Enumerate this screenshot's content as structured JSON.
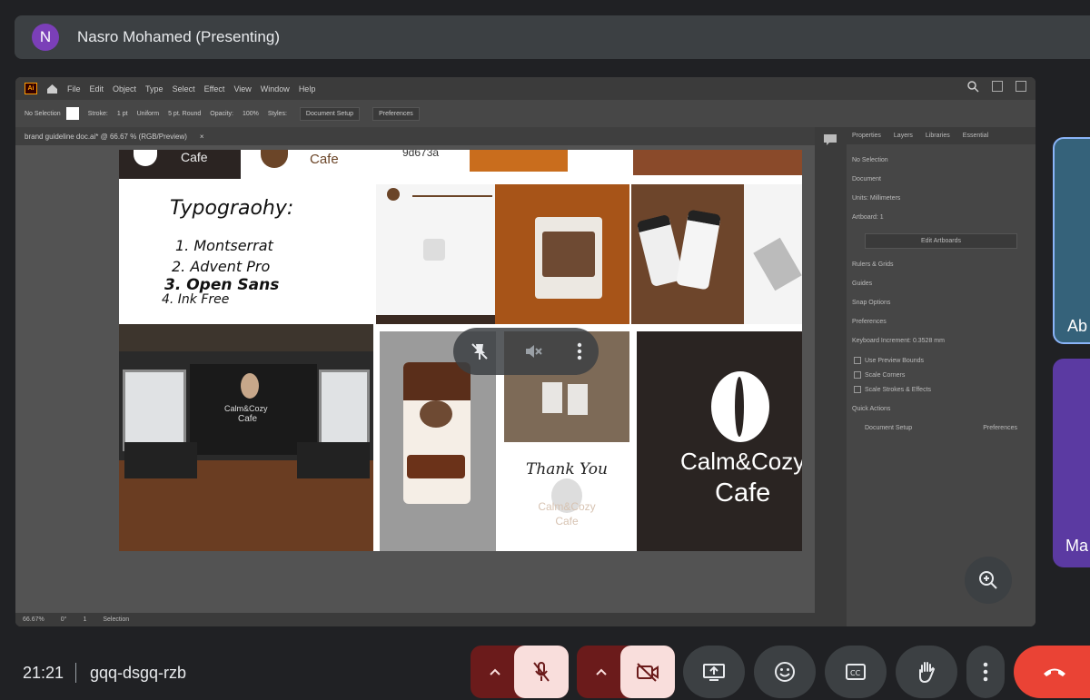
{
  "presenter": {
    "initial": "N",
    "label": "Nasro Mohamed (Presenting)",
    "avatar_color": "#7b3fb8"
  },
  "app": {
    "menu": [
      "File",
      "Edit",
      "Object",
      "Type",
      "Select",
      "Effect",
      "View",
      "Window",
      "Help"
    ],
    "control": {
      "selection": "No Selection",
      "stroke_label": "Stroke:",
      "stroke_value": "1 pt",
      "uniform": "Uniform",
      "brush": "5 pt. Round",
      "opacity_label": "Opacity:",
      "opacity_value": "100%",
      "styles_label": "Styles:",
      "doc_setup": "Document Setup",
      "preferences": "Preferences"
    },
    "doc_tab": "brand guideline doc.ai* @ 66.67 % (RGB/Preview)",
    "doc_tab_close": "×",
    "status": {
      "zoom": "66.67%",
      "angle": "0°",
      "artboard": "1",
      "tool": "Selection"
    }
  },
  "artboard": {
    "top_dark_text": "Cafe",
    "top_white_text": "Cafe",
    "hex": "9d673a",
    "typography": {
      "title": "Typograohy:",
      "items": [
        "1. Montserrat",
        "2. Advent Pro",
        "3. Open Sans",
        "4. Ink Free"
      ]
    },
    "room": {
      "line1": "Calm&Cozy",
      "line2": "Cafe"
    },
    "thanks": {
      "title": "Thank You",
      "sub1": "Calm&Cozy",
      "sub2": "Cafe"
    },
    "brand": {
      "line1": "Calm&Cozy",
      "line2": "Cafe"
    }
  },
  "right_panel": {
    "tabs": [
      "Properties",
      "Layers",
      "Libraries",
      "Essential"
    ],
    "no_selection": "No Selection",
    "document": "Document",
    "units_label": "Units:",
    "units_value": "Millimeters",
    "artboard_label": "Artboard:",
    "artboard_value": "1",
    "edit_artboards": "Edit Artboards",
    "rulers_grids": "Rulers & Grids",
    "guides": "Guides",
    "snap_options": "Snap Options",
    "preferences": "Preferences",
    "keyboard_increment": "Keyboard Increment:",
    "keyboard_value": "0.3528 mm",
    "checks": [
      "Use Preview Bounds",
      "Scale Corners",
      "Scale Strokes & Effects"
    ],
    "quick_actions": "Quick Actions",
    "doc_setup": "Document Setup",
    "prefs_btn": "Preferences"
  },
  "tiles": [
    {
      "label": "Ab",
      "color": "#35627a"
    },
    {
      "label": "Ma",
      "color": "#5b3aa2"
    }
  ],
  "bottom": {
    "time": "21:21",
    "code": "gqq-dsgq-rzb"
  },
  "colors": {
    "end_call": "#ea4335",
    "muted_bg": "#f9dedc",
    "muted_dark": "#6b1b1b",
    "control_bg": "#3c4043"
  }
}
